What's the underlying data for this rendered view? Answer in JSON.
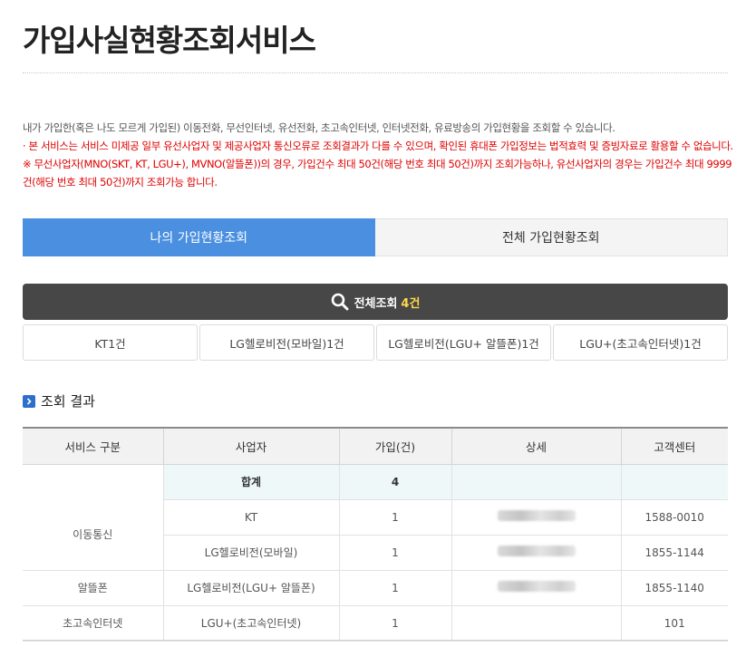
{
  "page": {
    "title": "가입사실현황조회서비스"
  },
  "description": {
    "line1": "내가 가입한(혹은 나도 모르게 가입된) 이동전화, 무선인터넷, 유선전화, 초고속인터넷, 인터넷전화, 유료방송의 가입현황을 조회할 수 있습니다.",
    "line2": "· 본 서비스는 서비스 미제공 일부 유선사업자 및 제공사업자 통신오류로 조회결과가 다를 수 있으며, 확인된 휴대폰 가입정보는 법적효력 및 증빙자료로 활용할 수 없습니다.",
    "line3": "※ 무선사업자(MNO(SKT, KT, LGU+), MVNO(알뜰폰))의 경우, 가입건수 최대 50건(해당 번호 최대 50건)까지 조회가능하나, 유선사업자의 경우는 가입건수 최대 9999건(해당 번호 최대 50건)까지 조회가능 합니다."
  },
  "tabs": [
    {
      "label": "나의 가입현황조회",
      "active": true
    },
    {
      "label": "전체 가입현황조회",
      "active": false
    }
  ],
  "summary": {
    "label": "전체조회",
    "count": "4건",
    "icon": "search-icon"
  },
  "carriers": [
    {
      "label": "KT1건"
    },
    {
      "label": "LG헬로비전(모바일)1건"
    },
    {
      "label": "LG헬로비전(LGU+ 알뜰폰)1건"
    },
    {
      "label": "LGU+(초고속인터넷)1건"
    }
  ],
  "results": {
    "section_title": "조회 결과",
    "headers": [
      "서비스 구분",
      "사업자",
      "가입(건)",
      "상세",
      "고객센터"
    ],
    "total": {
      "label": "합계",
      "count": "4"
    },
    "rows": [
      {
        "category": "이동통신",
        "provider": "KT",
        "count": "1",
        "center": "1588-0010"
      },
      {
        "category": "",
        "provider": "LG헬로비전(모바일)",
        "count": "1",
        "center": "1855-1144"
      },
      {
        "category": "알뜰폰",
        "provider": "LG헬로비전(LGU+ 알뜰폰)",
        "count": "1",
        "center": "1855-1140"
      },
      {
        "category": "초고속인터넷",
        "provider": "LGU+(초고속인터넷)",
        "count": "1",
        "center": "101"
      }
    ]
  },
  "colors": {
    "tab_active": "#4a8fe0",
    "total_bar": "#474747",
    "count_highlight": "#ffd94a",
    "warning_text": "#e00000",
    "sum_row": "#eef8f8",
    "section_icon": "#2d6fca"
  }
}
